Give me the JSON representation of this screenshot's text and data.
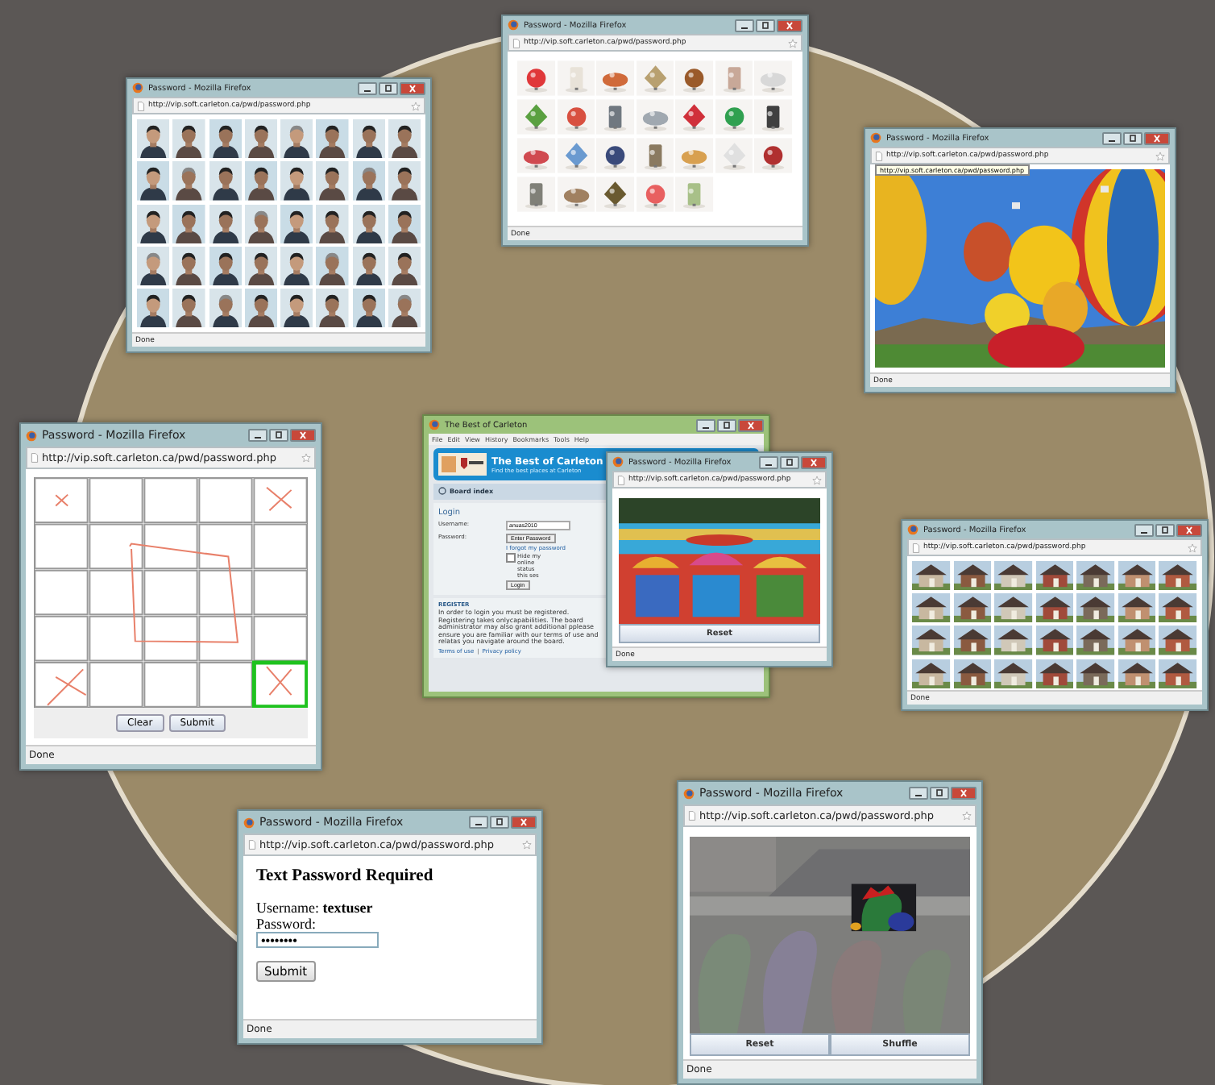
{
  "windows": [
    {
      "kind": "faces",
      "title": "Password - Mozilla Firefox",
      "url": "http://vip.soft.carleton.ca/pwd/password.php",
      "status": "Done"
    },
    {
      "kind": "objects",
      "title": "Password - Mozilla Firefox",
      "url": "http://vip.soft.carleton.ca/pwd/password.php",
      "status": "Done"
    },
    {
      "kind": "balloons",
      "title": "Password - Mozilla Firefox",
      "url": "http://vip.soft.carleton.ca/pwd/password.php",
      "tooltip": "http://vip.soft.carleton.ca/pwd/password.php",
      "status": "Done"
    },
    {
      "kind": "sketch",
      "title": "Password - Mozilla Firefox",
      "url": "http://vip.soft.carleton.ca/pwd/password.php",
      "cells": [
        {
          "selected": false
        },
        {
          "selected": false
        },
        {
          "selected": false
        },
        {
          "selected": false
        },
        {
          "selected": false
        },
        {
          "selected": false
        },
        {
          "selected": false
        },
        {
          "selected": false
        },
        {
          "selected": false
        },
        {
          "selected": false
        },
        {
          "selected": false
        },
        {
          "selected": false
        },
        {
          "selected": false
        },
        {
          "selected": false
        },
        {
          "selected": false
        },
        {
          "selected": false
        },
        {
          "selected": false
        },
        {
          "selected": false
        },
        {
          "selected": false
        },
        {
          "selected": false
        },
        {
          "selected": false
        },
        {
          "selected": false
        },
        {
          "selected": false
        },
        {
          "selected": false
        },
        {
          "selected": true
        }
      ],
      "buttons": [
        "Clear",
        "Submit"
      ],
      "status": "Done"
    },
    {
      "kind": "forum",
      "title": "The Best of Carleton",
      "menu": [
        "File",
        "Edit",
        "View",
        "History",
        "Bookmarks",
        "Tools",
        "Help"
      ],
      "site_title": "The Best of Carleton",
      "site_subtitle": "Find the best places at Carleton",
      "nav": "Board index",
      "login": {
        "heading": "Login",
        "username_label": "Username:",
        "username_value": "anuas2010",
        "password_label": "Password:",
        "password_button": "Enter Password",
        "forgot": "I forgot my password",
        "hide_label": "Hide my online status this ses",
        "hide_checked": false,
        "submit": "Login"
      },
      "register": {
        "heading": "REGISTER",
        "lines": [
          "In order to login you must be registered. Registering takes only",
          "capabilities. The board administrator may also grant additional p",
          "please ensure you are familiar with our terms of use and relat",
          "as you navigate around the board."
        ]
      },
      "footer_links": [
        "Terms of use",
        "Privacy policy"
      ],
      "footer_separator": "|"
    },
    {
      "kind": "boats",
      "title": "Password - Mozilla Firefox",
      "url": "http://vip.soft.carleton.ca/pwd/password.php",
      "buttons": [
        "Reset"
      ],
      "status": "Done"
    },
    {
      "kind": "houses",
      "title": "Password - Mozilla Firefox",
      "url": "http://vip.soft.carleton.ca/pwd/password.php",
      "status": "Done"
    },
    {
      "kind": "text",
      "title": "Password - Mozilla Firefox",
      "url": "http://vip.soft.carleton.ca/pwd/password.php",
      "heading": "Text Password Required",
      "username": "Username: **textuser**",
      "password_label": "Password:",
      "password_value": "••••••••",
      "buttons": [
        "Submit"
      ],
      "status": "Done"
    },
    {
      "kind": "dragon",
      "title": "Password - Mozilla Firefox",
      "url": "http://vip.soft.carleton.ca/pwd/password.php",
      "buttons": [
        "Reset",
        "Shuffle"
      ],
      "status": "Done"
    }
  ]
}
